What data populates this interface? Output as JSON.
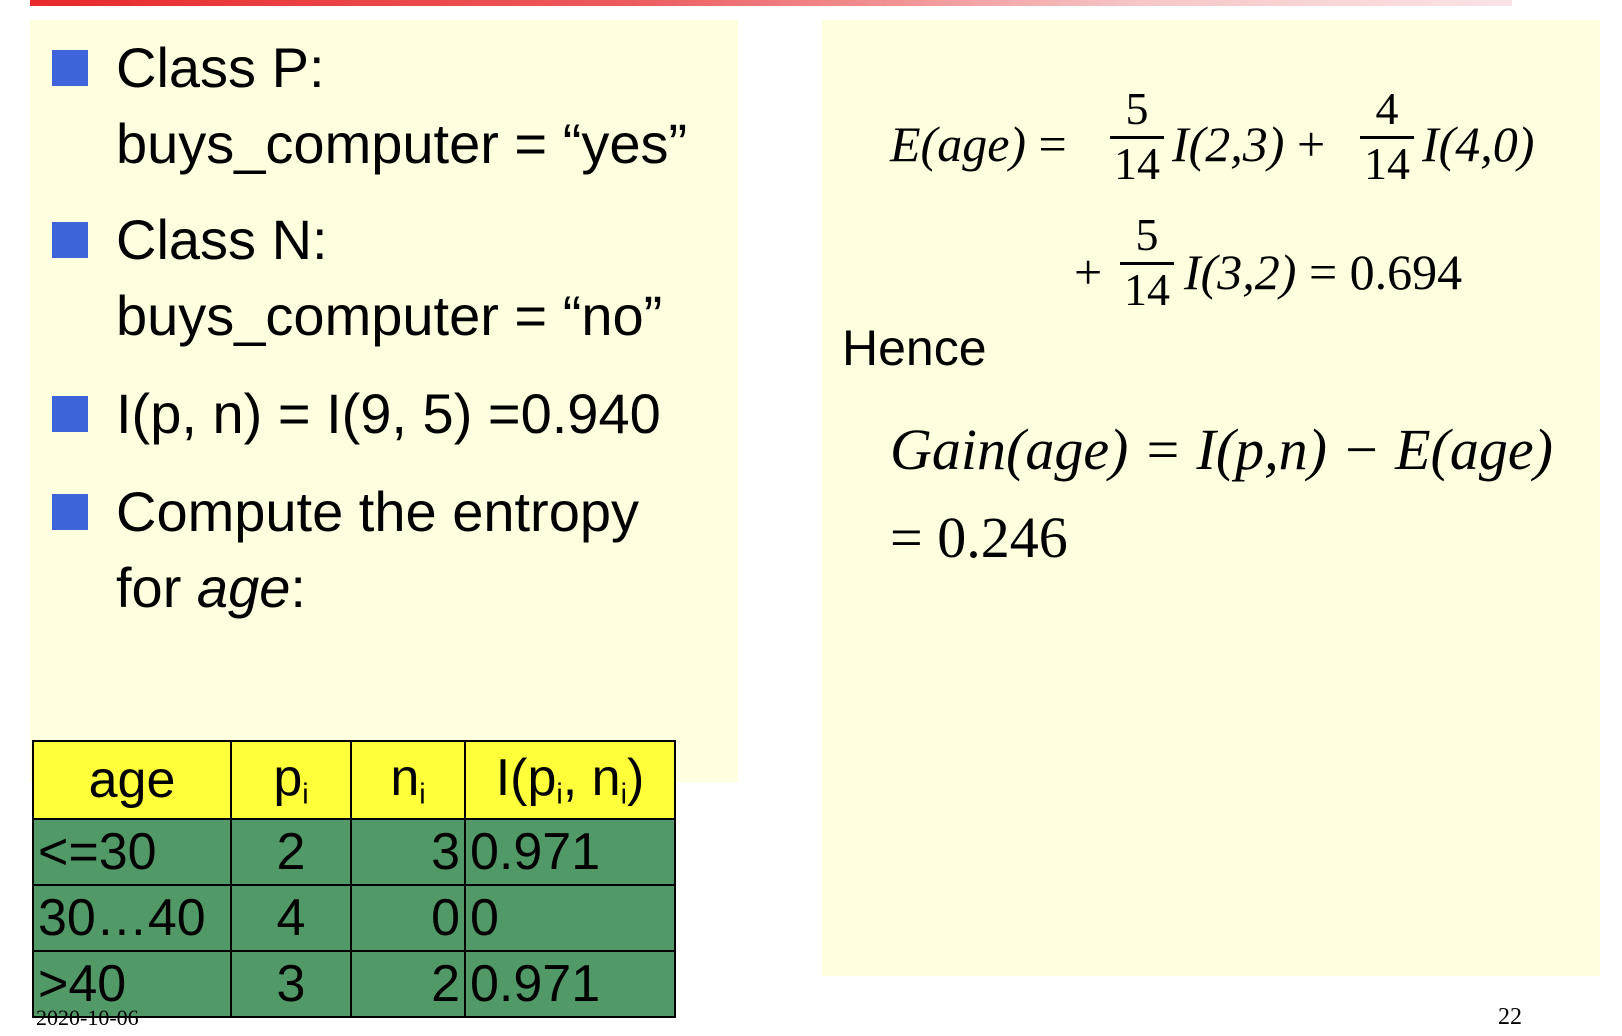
{
  "left": {
    "bullets": [
      {
        "text": "Class P:",
        "continuation": "buys_computer = “yes”"
      },
      {
        "text": "Class N:",
        "continuation": "buys_computer = “no”"
      },
      {
        "text": "I(p, n) = I(9, 5) =0.940"
      },
      {
        "text": "Compute the entropy",
        "continuation_prefix": "for ",
        "continuation_italic": "age",
        "continuation_suffix": ":"
      }
    ]
  },
  "table": {
    "headers": [
      "age",
      "p",
      "n",
      "I(p",
      ", n",
      ")"
    ],
    "header_sub": "i",
    "rows": [
      [
        "<=30",
        "2",
        "3",
        "0.971"
      ],
      [
        "30…40",
        "4",
        "0",
        "0"
      ],
      [
        ">40",
        "3",
        "2",
        "0.971"
      ]
    ]
  },
  "right": {
    "eq1_lhs": "E(age)",
    "eq1_equals": "=",
    "f1_num": "5",
    "f1_den": "14",
    "term1": "I(2,3)",
    "plus": "+",
    "f2_num": "4",
    "f2_den": "14",
    "term2": "I(4,0)",
    "f3_num": "5",
    "f3_den": "14",
    "term3": "I(3,2)",
    "eq1_result": "= 0.694",
    "hence": "Hence",
    "gain_expr": "Gain(age) = I(p,n) − E(age)",
    "gain_result": "= 0.246"
  },
  "footer": {
    "date": "2020-10-06",
    "page": "22"
  }
}
